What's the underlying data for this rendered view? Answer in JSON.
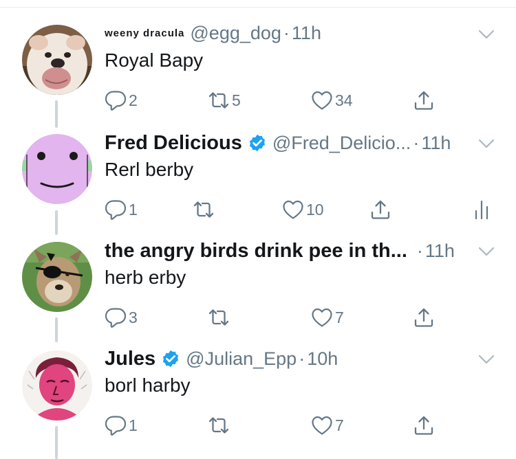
{
  "tweets": [
    {
      "display_name": "weeny dracula",
      "handle": "@egg_dog",
      "time": "11h",
      "text": "Royal Bapy",
      "verified": false,
      "replies": "2",
      "retweets": "5",
      "likes": "34"
    },
    {
      "display_name": "Fred Delicious",
      "handle": "@Fred_Delicio...",
      "time": "11h",
      "text": "Rerl berby",
      "verified": true,
      "replies": "1",
      "retweets": "",
      "likes": "10"
    },
    {
      "display_name": "the angry birds drink pee in th...",
      "handle": "",
      "time": "11h",
      "text": "herb erby",
      "verified": false,
      "replies": "3",
      "retweets": "",
      "likes": "7"
    },
    {
      "display_name": "Jules",
      "handle": "@Julian_Epp",
      "time": "10h",
      "text": "borl harby",
      "verified": true,
      "replies": "1",
      "retweets": "",
      "likes": "7"
    }
  ],
  "separator": "·",
  "colors": {
    "text": "#14171a",
    "secondary": "#657786",
    "verified": "#1da1f2",
    "thread_line": "#ccd6dd"
  },
  "icons": [
    "reply-icon",
    "retweet-icon",
    "like-icon",
    "share-icon",
    "analytics-icon",
    "chevron-down-icon",
    "verified-icon"
  ]
}
